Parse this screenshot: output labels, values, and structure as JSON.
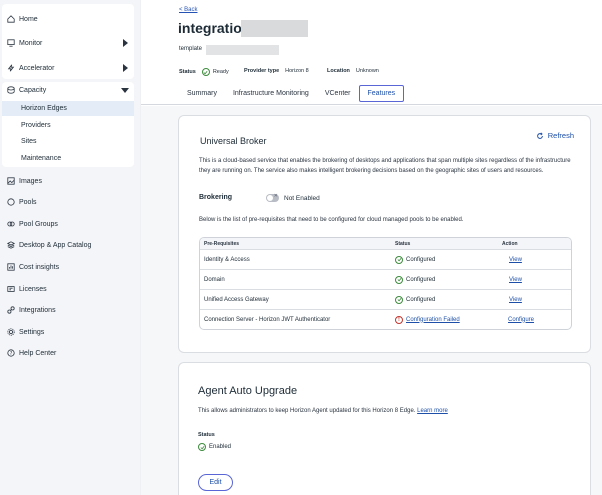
{
  "sidebar": {
    "top_items": [
      {
        "label": "Home",
        "icon": "home-icon"
      },
      {
        "label": "Monitor",
        "icon": "monitor-icon"
      },
      {
        "label": "Accelerator",
        "icon": "accelerator-icon"
      }
    ],
    "capacity": {
      "label": "Capacity",
      "icon": "capacity-icon",
      "children": [
        "Horizon Edges",
        "Providers",
        "Sites",
        "Maintenance"
      ],
      "active_child": "Horizon Edges"
    },
    "items": [
      {
        "label": "Images",
        "icon": "images-icon"
      },
      {
        "label": "Pools",
        "icon": "pools-icon"
      },
      {
        "label": "Pool Groups",
        "icon": "pool-groups-icon"
      },
      {
        "label": "Desktop & App Catalog",
        "icon": "catalog-icon"
      },
      {
        "label": "Cost insights",
        "icon": "cost-icon"
      },
      {
        "label": "Licenses",
        "icon": "licenses-icon"
      },
      {
        "label": "Integrations",
        "icon": "integrations-icon"
      },
      {
        "label": "Settings",
        "icon": "settings-icon"
      },
      {
        "label": "Help Center",
        "icon": "help-icon"
      }
    ]
  },
  "header": {
    "back_label": "< Back",
    "title": "integration",
    "subtitle": "template",
    "status_label": "Status",
    "status_value": "Ready",
    "provider_type_label": "Provider type",
    "provider_type_value": "Horizon 8",
    "location_label": "Location",
    "location_value": "Unknown"
  },
  "tabs": [
    "Summary",
    "Infrastructure Monitoring",
    "VCenter",
    "Features"
  ],
  "active_tab": "Features",
  "universal_broker": {
    "title": "Universal Broker",
    "refresh_label": "Refresh",
    "description": "This is a cloud-based service that enables the brokering of desktops and applications that span multiple sites regardless of the infrastructure they are running on. The service also makes intelligent brokering decisions based on the geographic sites of users and resources.",
    "brokering_label": "Brokering",
    "brokering_state": "Not Enabled",
    "prereq_text": "Below is the list of pre-requisites that need to be configured for cloud managed pools to be enabled.",
    "table": {
      "headers": [
        "Pre-Requisites",
        "Status",
        "Action"
      ],
      "rows": [
        {
          "name": "Identity & Access",
          "status": "Configured",
          "action": "View"
        },
        {
          "name": "Domain",
          "status": "Configured",
          "action": "View"
        },
        {
          "name": "Unified Access Gateway",
          "status": "Configured",
          "action": "View"
        },
        {
          "name": "Connection Server - Horizon JWT Authenticator",
          "status": "Configuration Failed",
          "action": "Configure"
        }
      ]
    }
  },
  "agent_upgrade": {
    "title": "Agent Auto Upgrade",
    "description": "This allows administrators to keep Horizon Agent updated for this Horizon 8 Edge.",
    "learn_more": "Learn more",
    "status_label": "Status",
    "status_value": "Enabled",
    "edit_label": "Edit"
  },
  "colors": {
    "accent": "#1d4fa8",
    "success": "#3d8b3d",
    "error": "#c2352f",
    "active_bg": "#e4edf7"
  }
}
